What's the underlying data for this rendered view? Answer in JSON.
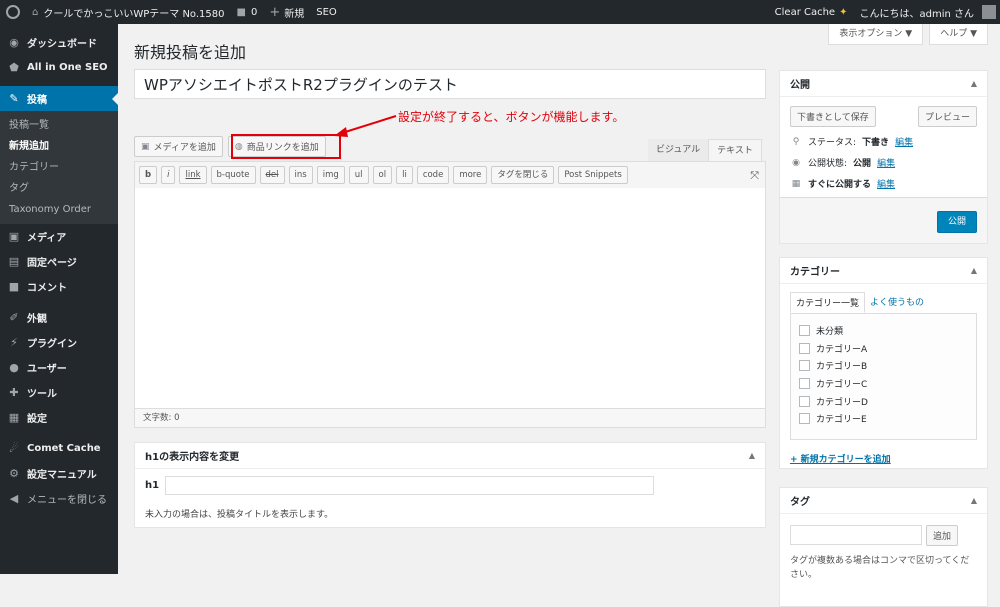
{
  "adminbar": {
    "site_name": "クールでかっこいいWPテーマ No.1580",
    "comments_count": "0",
    "new_label": "新規",
    "seo_label": "SEO",
    "clear_cache": "Clear Cache",
    "greeting": "こんにちは、admin さん"
  },
  "sidebar": {
    "dashboard": "ダッシュボード",
    "aioseo": "All in One SEO",
    "posts": "投稿",
    "sub": [
      "投稿一覧",
      "新規追加",
      "カテゴリー",
      "タグ",
      "Taxonomy Order"
    ],
    "media": "メディア",
    "pages": "固定ページ",
    "comments": "コメント",
    "appearance": "外観",
    "plugins": "プラグイン",
    "users": "ユーザー",
    "tools": "ツール",
    "settings": "設定",
    "comet": "Comet Cache",
    "manual": "設定マニュアル",
    "collapse": "メニューを閉じる"
  },
  "header": {
    "screen_options": "表示オプション ▼",
    "help": "ヘルプ ▼",
    "page_title": "新規投稿を追加"
  },
  "post": {
    "title": "WPアソシエイトポストR2プラグインのテスト",
    "annotation": "設定が終了すると、ボタンが機能します。",
    "add_media": "メディアを追加",
    "add_product_link": "商品リンクを追加",
    "tab_visual": "ビジュアル",
    "tab_text": "テキスト",
    "quicktags": [
      "b",
      "i",
      "link",
      "b-quote",
      "del",
      "ins",
      "img",
      "ul",
      "ol",
      "li",
      "code",
      "more",
      "タグを閉じる",
      "Post Snippets"
    ],
    "word_count": "文字数: 0"
  },
  "h1box": {
    "title": "h1の表示内容を変更",
    "label": "h1",
    "note": "未入力の場合は、投稿タイトルを表示します。"
  },
  "publish": {
    "title": "公開",
    "save_draft": "下書きとして保存",
    "preview": "プレビュー",
    "status_label": "ステータス:",
    "status_value": "下書き",
    "visibility_label": "公開状態:",
    "visibility_value": "公開",
    "schedule_label": "すぐに公開する",
    "edit": "編集",
    "publish_button": "公開"
  },
  "categories": {
    "title": "カテゴリー",
    "tab_all": "カテゴリー一覧",
    "tab_popular": "よく使うもの",
    "items": [
      "未分類",
      "カテゴリーA",
      "カテゴリーB",
      "カテゴリーC",
      "カテゴリーD",
      "カテゴリーE"
    ],
    "add_new": "+ 新規カテゴリーを追加"
  },
  "tags": {
    "title": "タグ",
    "add_button": "追加",
    "note": "タグが複数ある場合はコンマで区切ってください。"
  }
}
